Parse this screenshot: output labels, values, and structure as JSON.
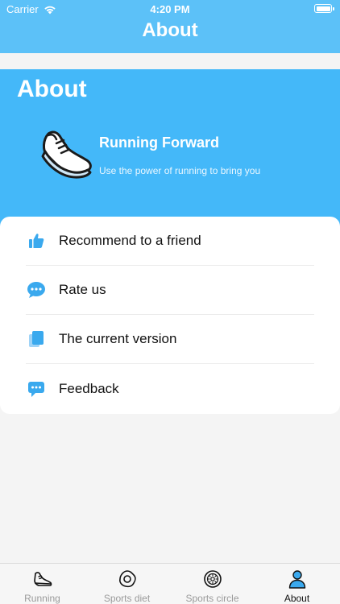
{
  "status_bar": {
    "carrier": "Carrier",
    "time": "4:20 PM"
  },
  "nav": {
    "title": "About"
  },
  "hero": {
    "heading": "About",
    "app_name": "Running Forward",
    "tagline": "Use the power of running to bring you"
  },
  "menu": {
    "items": [
      {
        "label": "Recommend to a friend",
        "icon": "thumbs-up-icon"
      },
      {
        "label": "Rate us",
        "icon": "chat-bubble-icon"
      },
      {
        "label": "The current version",
        "icon": "document-stack-icon"
      },
      {
        "label": "Feedback",
        "icon": "message-icon"
      }
    ]
  },
  "tab_bar": {
    "items": [
      {
        "label": "Running",
        "icon": "shoe-icon",
        "active": false
      },
      {
        "label": "Sports diet",
        "icon": "egg-icon",
        "active": false
      },
      {
        "label": "Sports circle",
        "icon": "kiwi-icon",
        "active": false
      },
      {
        "label": "About",
        "icon": "person-icon",
        "active": true
      }
    ]
  },
  "colors": {
    "nav_bar": "#5cc1f8",
    "hero": "#44b8f9",
    "icon_accent": "#3aa9ee",
    "background": "#f4f4f4"
  }
}
